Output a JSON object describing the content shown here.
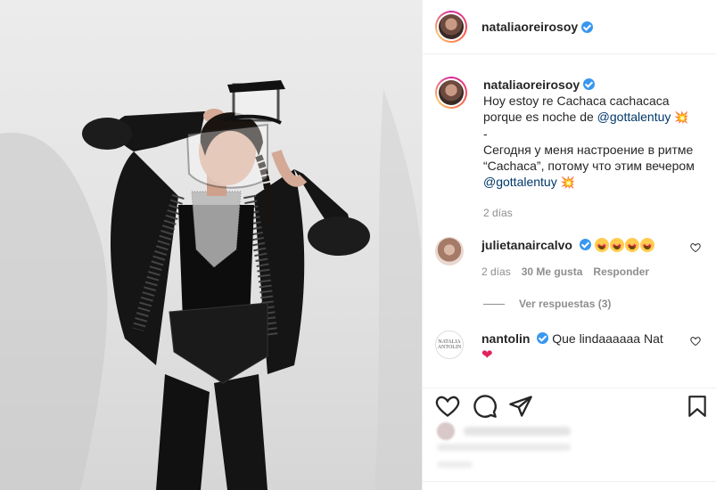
{
  "post": {
    "author": "nataliaoreirosoy",
    "caption": {
      "line1": "Hoy estoy re Cachaca cachacaca porque es noche de",
      "mention1": "@gottalentuy",
      "separator": "-",
      "line2": "Сегодня у меня настроение в ритме “Cachaca”, потому что этим вечером",
      "mention2": "@gottalentuy"
    },
    "time": "2 días"
  },
  "comments": [
    {
      "username": "julietanaircalvo",
      "text_emojis": "star-struck x4",
      "time": "2 días",
      "likes": "30 Me gusta",
      "reply": "Responder",
      "view_replies": "Ver respuestas (3)"
    },
    {
      "username": "nantolin",
      "text": "Que lindaaaaaa Nat",
      "avatar_text": "NATALIA ANTOLIN"
    }
  ],
  "icons": {
    "verified": "verified-badge-icon",
    "like": "heart-icon",
    "comment": "comment-icon",
    "share": "paper-plane-icon",
    "save": "bookmark-icon"
  },
  "colors": {
    "link": "#00376b",
    "verified": "#3897f0",
    "muted": "#8e8e8e"
  }
}
